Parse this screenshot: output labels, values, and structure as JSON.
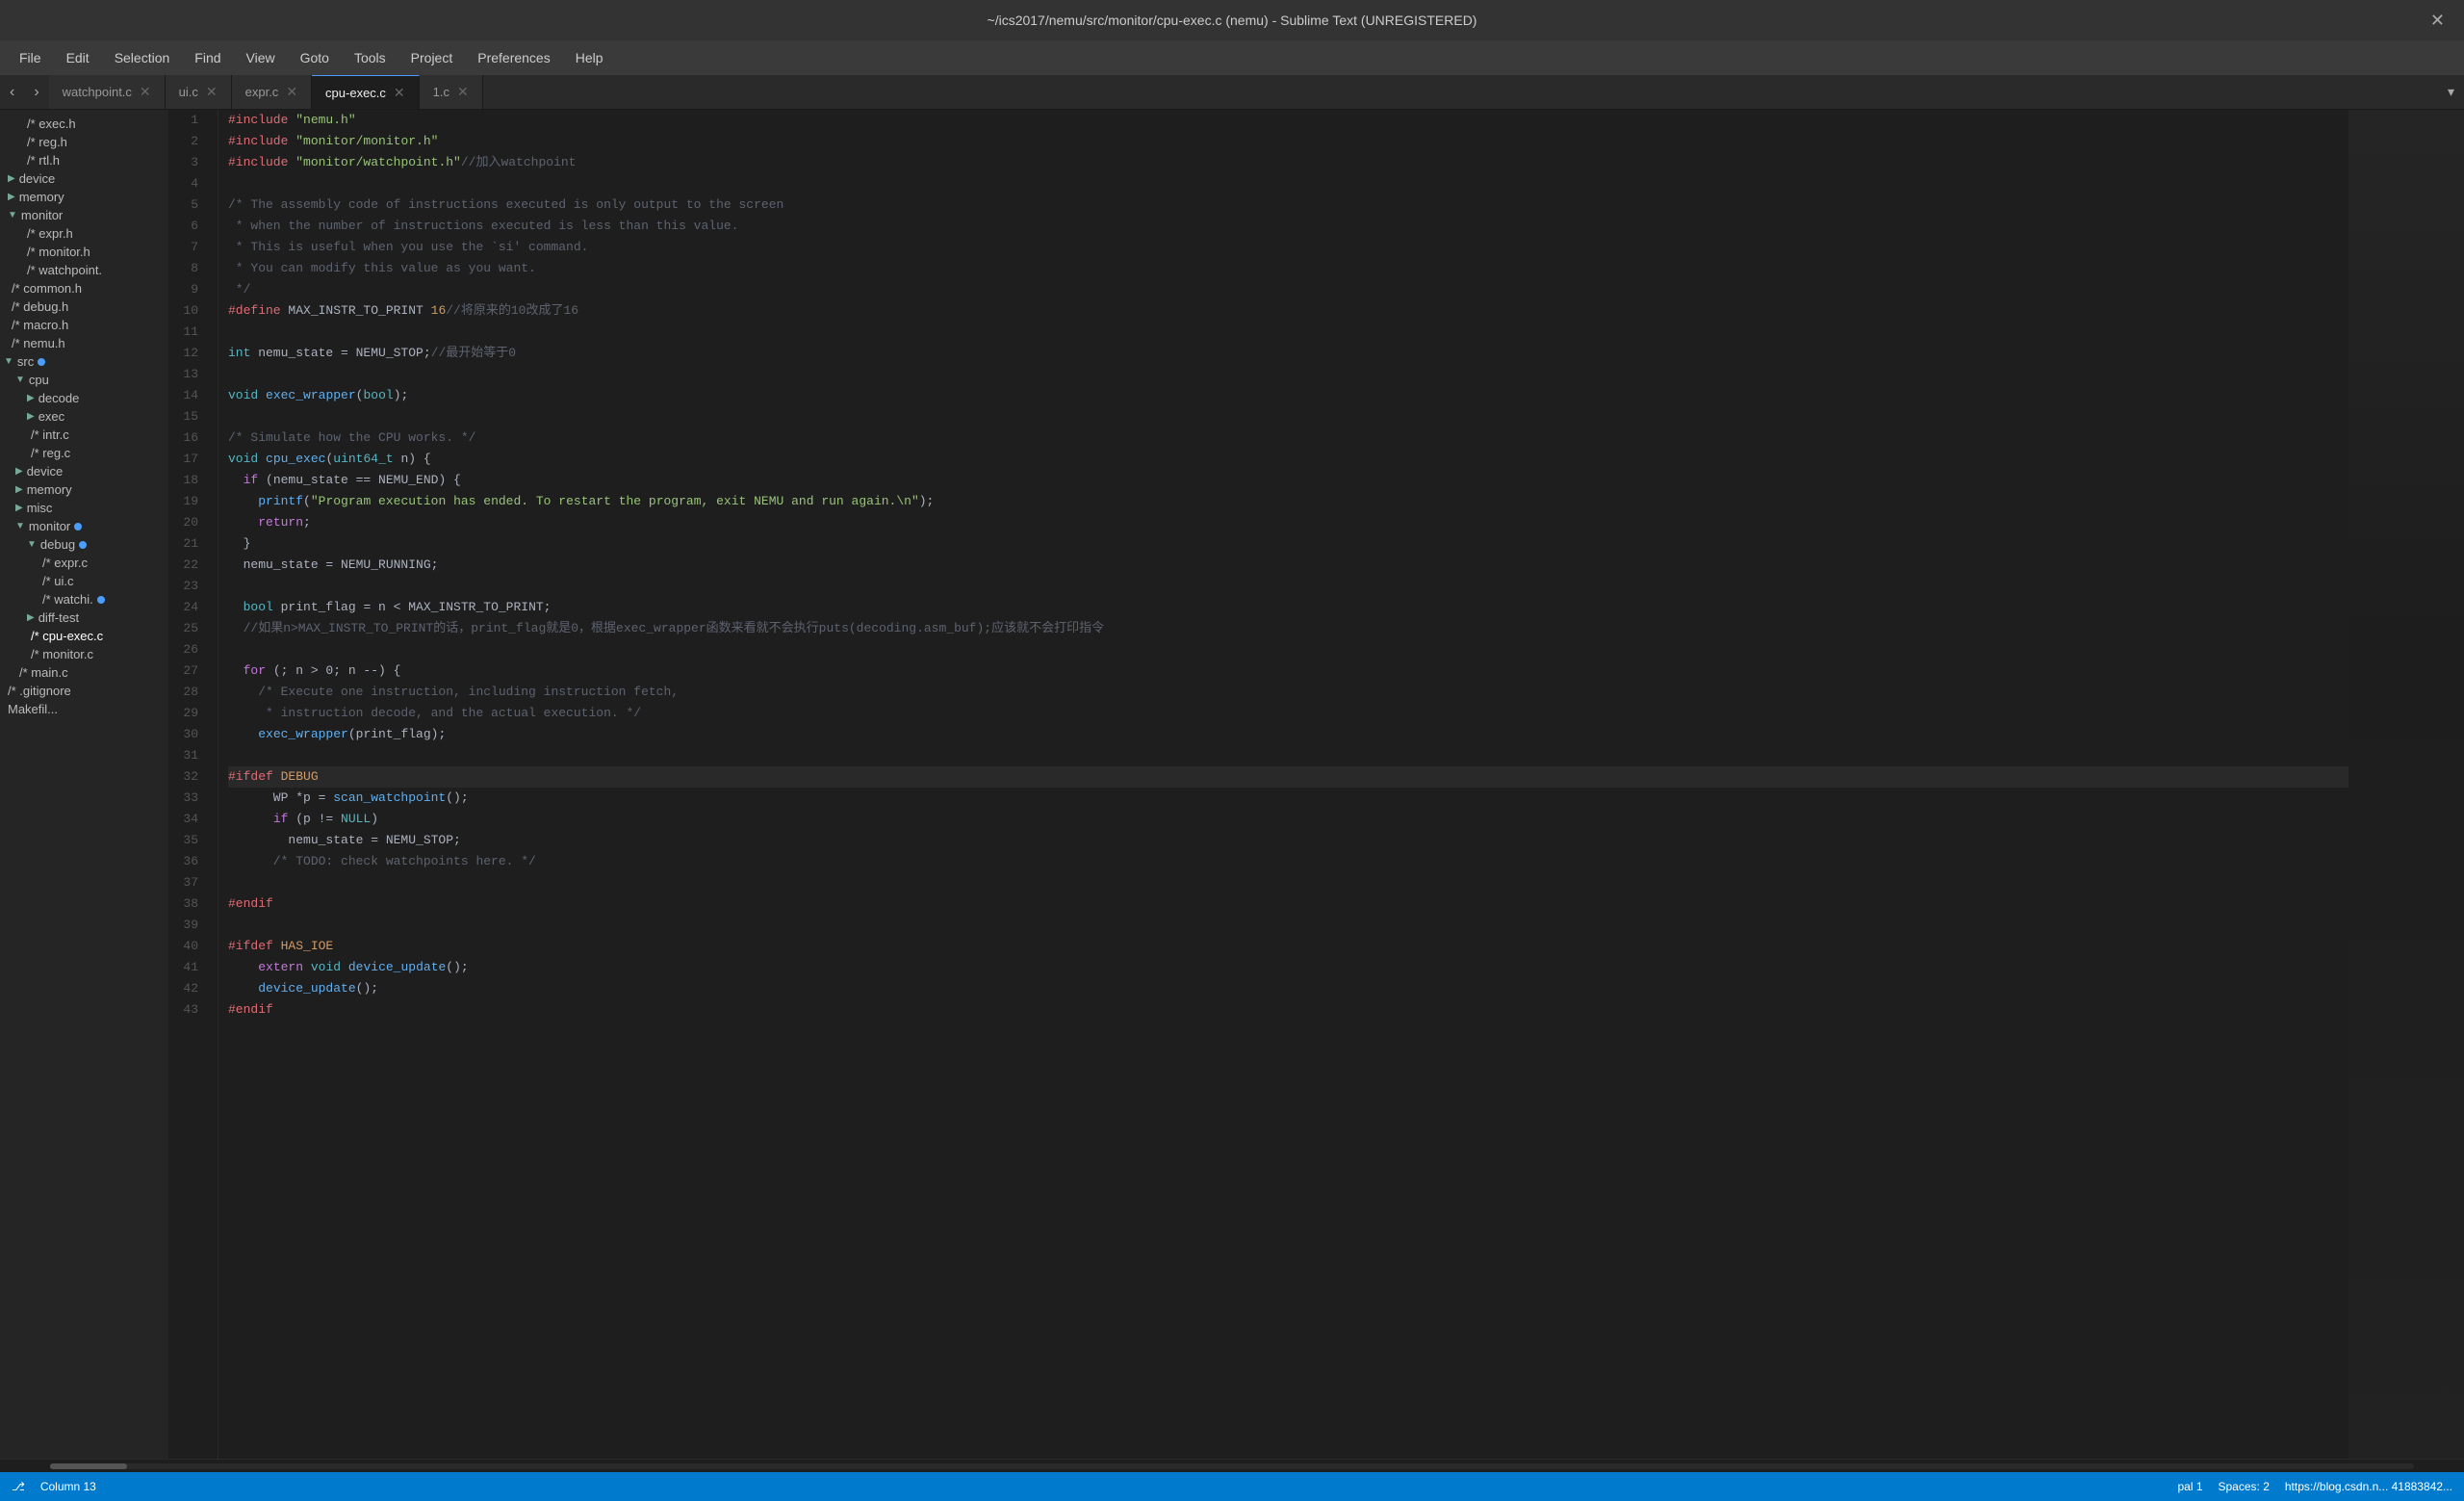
{
  "titlebar": {
    "title": "~/ics2017/nemu/src/monitor/cpu-exec.c (nemu) - Sublime Text (UNREGISTERED)",
    "close_label": "✕"
  },
  "menubar": {
    "items": [
      "File",
      "Edit",
      "Selection",
      "Find",
      "View",
      "Goto",
      "Tools",
      "Project",
      "Preferences",
      "Help"
    ]
  },
  "tabs": [
    {
      "label": "watchpoint.c",
      "active": false,
      "id": "tab-watchpoint"
    },
    {
      "label": "ui.c",
      "active": false,
      "id": "tab-ui"
    },
    {
      "label": "expr.c",
      "active": false,
      "id": "tab-expr"
    },
    {
      "label": "cpu-exec.c",
      "active": true,
      "id": "tab-cpu-exec"
    },
    {
      "label": "1.c",
      "active": false,
      "id": "tab-1c"
    }
  ],
  "sidebar": {
    "items": [
      {
        "label": "exec.h",
        "type": "file",
        "indent": 1,
        "dot": false
      },
      {
        "label": "reg.h",
        "type": "file",
        "indent": 1,
        "dot": false
      },
      {
        "label": "rtl.h",
        "type": "file",
        "indent": 1,
        "dot": false
      },
      {
        "label": "device",
        "type": "folder",
        "indent": 0,
        "dot": false
      },
      {
        "label": "memory",
        "type": "folder",
        "indent": 0,
        "dot": false
      },
      {
        "label": "monitor",
        "type": "folder-open",
        "indent": 0,
        "dot": false
      },
      {
        "label": "expr.h",
        "type": "file",
        "indent": 1,
        "dot": false
      },
      {
        "label": "monitor.h",
        "type": "file",
        "indent": 1,
        "dot": false
      },
      {
        "label": "watchpoint.",
        "type": "file",
        "indent": 1,
        "dot": false
      },
      {
        "label": "common.h",
        "type": "file",
        "indent": 0,
        "dot": false
      },
      {
        "label": "debug.h",
        "type": "file",
        "indent": 0,
        "dot": false
      },
      {
        "label": "macro.h",
        "type": "file",
        "indent": 0,
        "dot": false
      },
      {
        "label": "nemu.h",
        "type": "file",
        "indent": 0,
        "dot": false
      },
      {
        "label": "src",
        "type": "folder-open",
        "indent": 0,
        "dot": true
      },
      {
        "label": "cpu",
        "type": "folder-open",
        "indent": 1,
        "dot": false
      },
      {
        "label": "decode",
        "type": "folder",
        "indent": 2,
        "dot": false
      },
      {
        "label": "exec",
        "type": "folder",
        "indent": 2,
        "dot": false
      },
      {
        "label": "intr.c",
        "type": "file",
        "indent": 2,
        "dot": false
      },
      {
        "label": "reg.c",
        "type": "file",
        "indent": 2,
        "dot": false
      },
      {
        "label": "device",
        "type": "folder",
        "indent": 1,
        "dot": false
      },
      {
        "label": "memory",
        "type": "folder",
        "indent": 1,
        "dot": false
      },
      {
        "label": "misc",
        "type": "folder",
        "indent": 1,
        "dot": false
      },
      {
        "label": "monitor",
        "type": "folder-open",
        "indent": 1,
        "dot": true
      },
      {
        "label": "debug",
        "type": "folder-open",
        "indent": 2,
        "dot": true
      },
      {
        "label": "expr.c",
        "type": "file",
        "indent": 3,
        "dot": false
      },
      {
        "label": "ui.c",
        "type": "file",
        "indent": 3,
        "dot": false
      },
      {
        "label": "watch.",
        "type": "file",
        "indent": 3,
        "dot": true
      },
      {
        "label": "diff-test",
        "type": "folder",
        "indent": 2,
        "dot": false
      },
      {
        "label": "cpu-exec.c",
        "type": "file",
        "indent": 2,
        "dot": false,
        "active": true
      },
      {
        "label": "monitor.c",
        "type": "file",
        "indent": 2,
        "dot": false
      },
      {
        "label": "main.c",
        "type": "file",
        "indent": 1,
        "dot": false
      },
      {
        "label": ".gitignore",
        "type": "file",
        "indent": 0,
        "dot": false
      },
      {
        "label": "Makefil...",
        "type": "file",
        "indent": 0,
        "dot": false
      }
    ]
  },
  "code": {
    "lines": [
      {
        "num": 1,
        "content": "#include \"nemu.h\"",
        "tokens": [
          {
            "t": "pre",
            "v": "#include"
          },
          {
            "t": "str",
            "v": " \"nemu.h\""
          }
        ]
      },
      {
        "num": 2,
        "content": "#include \"monitor/monitor.h\"",
        "tokens": [
          {
            "t": "pre",
            "v": "#include"
          },
          {
            "t": "str",
            "v": " \"monitor/monitor.h\""
          }
        ]
      },
      {
        "num": 3,
        "content": "#include \"monitor/watchpoint.h\"//加入watchpoint",
        "tokens": [
          {
            "t": "pre",
            "v": "#include"
          },
          {
            "t": "str",
            "v": " \"monitor/watchpoint.h\""
          },
          {
            "t": "cmt",
            "v": "//加入watchpoint"
          }
        ]
      },
      {
        "num": 4,
        "content": "",
        "tokens": []
      },
      {
        "num": 5,
        "content": "/* The assembly code of instructions executed is only output to the screen",
        "tokens": [
          {
            "t": "cmt",
            "v": "/* The assembly code of instructions executed is only output to the screen"
          }
        ]
      },
      {
        "num": 6,
        "content": " * when the number of instructions executed is less than this value.",
        "tokens": [
          {
            "t": "cmt",
            "v": " * when the number of instructions executed is less than this value."
          }
        ]
      },
      {
        "num": 7,
        "content": " * This is useful when you use the `si' command.",
        "tokens": [
          {
            "t": "cmt",
            "v": " * This is useful when you use the `si' command."
          }
        ]
      },
      {
        "num": 8,
        "content": " * You can modify this value as you want.",
        "tokens": [
          {
            "t": "cmt",
            "v": " * You can modify this value as you want."
          }
        ]
      },
      {
        "num": 9,
        "content": " */",
        "tokens": [
          {
            "t": "cmt",
            "v": " */"
          }
        ]
      },
      {
        "num": 10,
        "content": "#define MAX_INSTR_TO_PRINT 16//将原来的10改成了16",
        "tokens": [
          {
            "t": "pre",
            "v": "#define"
          },
          {
            "t": "op",
            "v": " MAX_INSTR_TO_PRINT "
          },
          {
            "t": "pre-val",
            "v": "16"
          },
          {
            "t": "cmt",
            "v": "//将原来的10改成了16"
          }
        ]
      },
      {
        "num": 11,
        "content": "",
        "tokens": []
      },
      {
        "num": 12,
        "content": "int nemu_state = NEMU_STOP;//最开始等于0",
        "tokens": [
          {
            "t": "kw2",
            "v": "int"
          },
          {
            "t": "op",
            "v": " nemu_state = NEMU_STOP;"
          },
          {
            "t": "cmt",
            "v": "//最开始等于0"
          }
        ]
      },
      {
        "num": 13,
        "content": "",
        "tokens": []
      },
      {
        "num": 14,
        "content": "void exec_wrapper(bool);",
        "tokens": [
          {
            "t": "kw2",
            "v": "void"
          },
          {
            "t": "op",
            "v": " "
          },
          {
            "t": "fn",
            "v": "exec_wrapper"
          },
          {
            "t": "op",
            "v": "("
          },
          {
            "t": "kw2",
            "v": "bool"
          },
          {
            "t": "op",
            "v": ");"
          }
        ]
      },
      {
        "num": 15,
        "content": "",
        "tokens": []
      },
      {
        "num": 16,
        "content": "/* Simulate how the CPU works. */",
        "tokens": [
          {
            "t": "cmt",
            "v": "/* Simulate how the CPU works. */"
          }
        ]
      },
      {
        "num": 17,
        "content": "void cpu_exec(uint64_t n) {",
        "tokens": [
          {
            "t": "kw2",
            "v": "void"
          },
          {
            "t": "op",
            "v": " "
          },
          {
            "t": "fn",
            "v": "cpu_exec"
          },
          {
            "t": "op",
            "v": "("
          },
          {
            "t": "kw2",
            "v": "uint64_t"
          },
          {
            "t": "op",
            "v": " n) {"
          }
        ]
      },
      {
        "num": 18,
        "content": "  if (nemu_state == NEMU_END) {",
        "tokens": [
          {
            "t": "op",
            "v": "  "
          },
          {
            "t": "kw",
            "v": "if"
          },
          {
            "t": "op",
            "v": " (nemu_state == NEMU_END) {"
          }
        ]
      },
      {
        "num": 19,
        "content": "    printf(\"Program execution has ended. To restart the program, exit NEMU and run again.\\n\");",
        "tokens": [
          {
            "t": "op",
            "v": "    "
          },
          {
            "t": "fn",
            "v": "printf"
          },
          {
            "t": "op",
            "v": "("
          },
          {
            "t": "str",
            "v": "\"Program execution has ended. To restart the program, exit NEMU and run again.\\n\""
          },
          {
            "t": "op",
            "v": ");"
          }
        ]
      },
      {
        "num": 20,
        "content": "    return;",
        "tokens": [
          {
            "t": "op",
            "v": "    "
          },
          {
            "t": "kw",
            "v": "return"
          },
          {
            "t": "op",
            "v": ";"
          }
        ]
      },
      {
        "num": 21,
        "content": "  }",
        "tokens": [
          {
            "t": "op",
            "v": "  }"
          }
        ]
      },
      {
        "num": 22,
        "content": "  nemu_state = NEMU_RUNNING;",
        "tokens": [
          {
            "t": "op",
            "v": "  nemu_state = NEMU_RUNNING;"
          }
        ]
      },
      {
        "num": 23,
        "content": "",
        "tokens": []
      },
      {
        "num": 24,
        "content": "  bool print_flag = n < MAX_INSTR_TO_PRINT;",
        "tokens": [
          {
            "t": "op",
            "v": "  "
          },
          {
            "t": "kw2",
            "v": "bool"
          },
          {
            "t": "op",
            "v": " print_flag = n < MAX_INSTR_TO_PRINT;"
          }
        ]
      },
      {
        "num": 25,
        "content": "  //如果n>MAX_INSTR_TO_PRINT的话，print_flag就是0，根据exec_wrapper函数来看就不会执行puts(decoding.asm_buf);应该就不会打印指令",
        "tokens": [
          {
            "t": "cmt",
            "v": "  //如果n>MAX_INSTR_TO_PRINT的话，print_flag就是0，根据exec_wrapper函数来看就不会执行puts(decoding.asm_buf);应该就不会打印指令"
          }
        ]
      },
      {
        "num": 26,
        "content": "",
        "tokens": []
      },
      {
        "num": 27,
        "content": "  for (; n > 0; n --) {",
        "tokens": [
          {
            "t": "op",
            "v": "  "
          },
          {
            "t": "kw",
            "v": "for"
          },
          {
            "t": "op",
            "v": " (; n > 0; n --) {"
          }
        ]
      },
      {
        "num": 28,
        "content": "    /* Execute one instruction, including instruction fetch,",
        "tokens": [
          {
            "t": "cmt",
            "v": "    /* Execute one instruction, including instruction fetch,"
          }
        ]
      },
      {
        "num": 29,
        "content": "     * instruction decode, and the actual execution. */",
        "tokens": [
          {
            "t": "cmt",
            "v": "     * instruction decode, and the actual execution. */"
          }
        ]
      },
      {
        "num": 30,
        "content": "    exec_wrapper(print_flag);",
        "tokens": [
          {
            "t": "op",
            "v": "    "
          },
          {
            "t": "fn",
            "v": "exec_wrapper"
          },
          {
            "t": "op",
            "v": "(print_flag);"
          }
        ]
      },
      {
        "num": 31,
        "content": "",
        "tokens": []
      },
      {
        "num": 32,
        "content": "#ifdef DEBUG",
        "tokens": [
          {
            "t": "pre",
            "v": "#ifdef"
          },
          {
            "t": "op",
            "v": " "
          },
          {
            "t": "pre-val",
            "v": "DEBUG"
          }
        ],
        "cursor": true
      },
      {
        "num": 33,
        "content": "      WP *p = scan_watchpoint();",
        "tokens": [
          {
            "t": "op",
            "v": "      WP *p = "
          },
          {
            "t": "fn",
            "v": "scan_watchpoint"
          },
          {
            "t": "op",
            "v": "();"
          }
        ]
      },
      {
        "num": 34,
        "content": "      if (p != NULL)",
        "tokens": [
          {
            "t": "op",
            "v": "      "
          },
          {
            "t": "kw",
            "v": "if"
          },
          {
            "t": "op",
            "v": " (p != "
          },
          {
            "t": "null",
            "v": "NULL"
          },
          {
            "t": "op",
            "v": ")"
          }
        ]
      },
      {
        "num": 35,
        "content": "        nemu_state = NEMU_STOP;",
        "tokens": [
          {
            "t": "op",
            "v": "        nemu_state = NEMU_STOP;"
          }
        ]
      },
      {
        "num": 36,
        "content": "      /* TODO: check watchpoints here. */",
        "tokens": [
          {
            "t": "cmt",
            "v": "      /* TODO: check watchpoints here. */"
          }
        ]
      },
      {
        "num": 37,
        "content": "",
        "tokens": []
      },
      {
        "num": 38,
        "content": "#endif",
        "tokens": [
          {
            "t": "pre",
            "v": "#endif"
          }
        ]
      },
      {
        "num": 39,
        "content": "",
        "tokens": []
      },
      {
        "num": 40,
        "content": "#ifdef HAS_IOE",
        "tokens": [
          {
            "t": "pre",
            "v": "#ifdef"
          },
          {
            "t": "op",
            "v": " "
          },
          {
            "t": "pre-val",
            "v": "HAS_IOE"
          }
        ]
      },
      {
        "num": 41,
        "content": "    extern void device_update();",
        "tokens": [
          {
            "t": "op",
            "v": "    "
          },
          {
            "t": "kw",
            "v": "extern"
          },
          {
            "t": "op",
            "v": " "
          },
          {
            "t": "kw2",
            "v": "void"
          },
          {
            "t": "op",
            "v": " "
          },
          {
            "t": "fn",
            "v": "device_update"
          },
          {
            "t": "op",
            "v": "();"
          }
        ]
      },
      {
        "num": 42,
        "content": "    device_update();",
        "tokens": [
          {
            "t": "op",
            "v": "    "
          },
          {
            "t": "fn",
            "v": "device_update"
          },
          {
            "t": "op",
            "v": "();"
          }
        ]
      },
      {
        "num": 43,
        "content": "#endif",
        "tokens": [
          {
            "t": "pre",
            "v": "#endif"
          }
        ]
      }
    ]
  },
  "statusbar": {
    "left": [
      "⎇",
      "pal",
      "1"
    ],
    "column": "Column 13",
    "right_items": [
      "Spaces: 2",
      "https://blog.csdn.n...",
      "4188384..."
    ]
  }
}
